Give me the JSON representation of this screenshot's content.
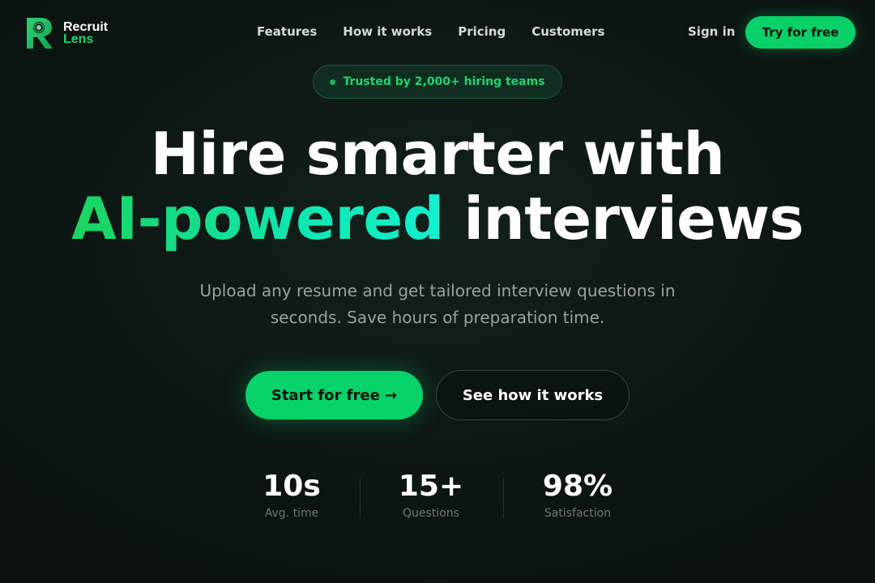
{
  "brand": {
    "name_line1": "Recruit",
    "name_line2": "Lens",
    "accent": "#1fd472"
  },
  "nav": {
    "links": [
      "Features",
      "How it works",
      "Pricing",
      "Customers"
    ],
    "signin": "Sign in",
    "cta": "Try for free"
  },
  "badge": {
    "text": "Trusted by 2,000+ hiring teams"
  },
  "hero": {
    "line1": "Hire smarter with",
    "highlight": "AI-powered",
    "rest": " interviews",
    "subtitle_line1": "Upload any resume and get tailored interview questions in",
    "subtitle_line2": "seconds. Save hours of preparation time."
  },
  "cta": {
    "primary": "Start for free →",
    "secondary": "See how it works"
  },
  "stats": [
    {
      "value": "10s",
      "label": "Avg. time"
    },
    {
      "value": "15+",
      "label": "Questions"
    },
    {
      "value": "98%",
      "label": "Satisfaction"
    }
  ]
}
